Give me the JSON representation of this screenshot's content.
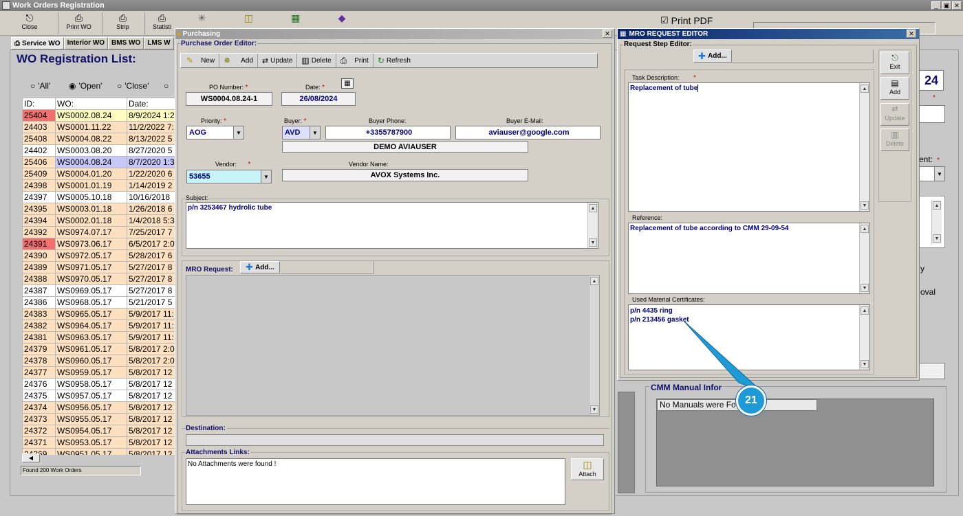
{
  "main": {
    "title": "Work Orders Registration",
    "toolbar": [
      {
        "label": "Close",
        "icon": "door-icon"
      },
      {
        "label": "Print WO",
        "icon": "printer-icon"
      },
      {
        "label": "Strip",
        "icon": "printer-icon"
      },
      {
        "label": "Statisti",
        "icon": "printer-icon"
      }
    ],
    "print_pdf": "Print PDF",
    "tabs": [
      "Service WO",
      "Interior WO",
      "BMS WO",
      "LMS W"
    ],
    "list_title": "WO Registration List:",
    "filters": [
      "'All'",
      "'Open'",
      "'Close'"
    ],
    "columns": [
      "ID:",
      "WO:",
      "Date:"
    ],
    "rows": [
      {
        "id": "25404",
        "wo": "WS0002.08.24",
        "date": "8/9/2024 1:2",
        "style": "red-yellow"
      },
      {
        "id": "24403",
        "wo": "WS0001.11.22",
        "date": "11/2/2022 7:",
        "style": "peach"
      },
      {
        "id": "25408",
        "wo": "WS0004.08.22",
        "date": "8/13/2022 5",
        "style": "peach"
      },
      {
        "id": "24402",
        "wo": "WS0003.08.20",
        "date": "8/27/2020 5",
        "style": "white"
      },
      {
        "id": "25406",
        "wo": "WS0004.08.24",
        "date": "8/7/2020 1:3",
        "style": "blue"
      },
      {
        "id": "25409",
        "wo": "WS0004.01.20",
        "date": "1/22/2020 6",
        "style": "peach"
      },
      {
        "id": "24398",
        "wo": "WS0001.01.19",
        "date": "1/14/2019 2",
        "style": "peach"
      },
      {
        "id": "24397",
        "wo": "WS0005.10.18",
        "date": "10/16/2018",
        "style": "white"
      },
      {
        "id": "24395",
        "wo": "WS0003.01.18",
        "date": "1/26/2018 6",
        "style": "peach"
      },
      {
        "id": "24394",
        "wo": "WS0002.01.18",
        "date": "1/4/2018 5:3",
        "style": "peach"
      },
      {
        "id": "24392",
        "wo": "WS0974.07.17",
        "date": "7/25/2017 7",
        "style": "peach"
      },
      {
        "id": "24391",
        "wo": "WS0973.06.17",
        "date": "6/5/2017 2:0",
        "style": "red"
      },
      {
        "id": "24390",
        "wo": "WS0972.05.17",
        "date": "5/28/2017 6",
        "style": "peach"
      },
      {
        "id": "24389",
        "wo": "WS0971.05.17",
        "date": "5/27/2017 8",
        "style": "peach"
      },
      {
        "id": "24388",
        "wo": "WS0970.05.17",
        "date": "5/27/2017 8",
        "style": "peach"
      },
      {
        "id": "24387",
        "wo": "WS0969.05.17",
        "date": "5/27/2017 8",
        "style": "white"
      },
      {
        "id": "24386",
        "wo": "WS0968.05.17",
        "date": "5/21/2017 5",
        "style": "white"
      },
      {
        "id": "24383",
        "wo": "WS0965.05.17",
        "date": "5/9/2017 11:",
        "style": "peach"
      },
      {
        "id": "24382",
        "wo": "WS0964.05.17",
        "date": "5/9/2017 11:",
        "style": "peach"
      },
      {
        "id": "24381",
        "wo": "WS0963.05.17",
        "date": "5/9/2017 11:",
        "style": "peach"
      },
      {
        "id": "24379",
        "wo": "WS0961.05.17",
        "date": "5/8/2017 2:0",
        "style": "peach"
      },
      {
        "id": "24378",
        "wo": "WS0960.05.17",
        "date": "5/8/2017 2:0",
        "style": "peach"
      },
      {
        "id": "24377",
        "wo": "WS0959.05.17",
        "date": "5/8/2017 12",
        "style": "peach"
      },
      {
        "id": "24376",
        "wo": "WS0958.05.17",
        "date": "5/8/2017 12",
        "style": "white"
      },
      {
        "id": "24375",
        "wo": "WS0957.05.17",
        "date": "5/8/2017 12",
        "style": "white"
      },
      {
        "id": "24374",
        "wo": "WS0956.05.17",
        "date": "5/8/2017 12",
        "style": "peach"
      },
      {
        "id": "24373",
        "wo": "WS0955.05.17",
        "date": "5/8/2017 12",
        "style": "peach"
      },
      {
        "id": "24372",
        "wo": "WS0954.05.17",
        "date": "5/8/2017 12",
        "style": "peach"
      },
      {
        "id": "24371",
        "wo": "WS0953.05.17",
        "date": "5/8/2017 12",
        "style": "peach"
      },
      {
        "id": "24369",
        "wo": "WS0951.05.17",
        "date": "5/8/2017 12",
        "style": "peach"
      }
    ],
    "footer": "Found 200 Work Orders",
    "right_num": "24",
    "right_partial_1": "ent:",
    "right_partial_2": "y",
    "right_partial_3": "oval",
    "cmm_title": "CMM Manual Infor",
    "cmm_text": "No Manuals were Fo"
  },
  "purchasing": {
    "title": "Purchasing",
    "group": "Purchase Order Editor:",
    "toolbar": [
      "New",
      "Add",
      "Update",
      "Delete",
      "Print",
      "Refresh"
    ],
    "po_number_label": "PO Number:",
    "po_number": "WS0004.08.24-1",
    "date_label": "Date:",
    "date": "26/08/2024",
    "priority_label": "Priority:",
    "priority": "AOG",
    "buyer_label": "Buyer:",
    "buyer": "AVD",
    "buyer_phone_label": "Buyer Phone:",
    "buyer_phone": "+3355787900",
    "buyer_email_label": "Buyer E-Mail:",
    "buyer_email": "aviauser@google.com",
    "buyer_name": "DEMO AVIAUSER",
    "vendor_label": "Vendor:",
    "vendor": "53655",
    "vendor_name_label": "Vendor Name:",
    "vendor_name": "AVOX Systems Inc.",
    "subject_label": "Subject:",
    "subject": "p/n 3253467 hydrolic tube",
    "mro_label": "MRO Request:",
    "mro_add": "Add...",
    "destination_label": "Destination:",
    "attachments_label": "Attachments Links:",
    "attachments_text": "No Attachments were found !",
    "attach_button": "Attach"
  },
  "mro": {
    "title": "MRO REQUEST EDITOR",
    "group": "Request Step Editor:",
    "add": "Add...",
    "side_buttons": [
      "Exit",
      "Add",
      "Update",
      "Delete"
    ],
    "task_label": "Task Description:",
    "task": "Replacement of tube",
    "reference_label": "Reference:",
    "reference": "Replacement of tube according to CMM 29-09-54",
    "certs_label": "Used Material Certificates:",
    "cert_line1": "p/n 4435 ring",
    "cert_line2": "p/n 213456 gasket"
  },
  "callout": {
    "number": "21",
    "color": "#1e9ad6"
  }
}
